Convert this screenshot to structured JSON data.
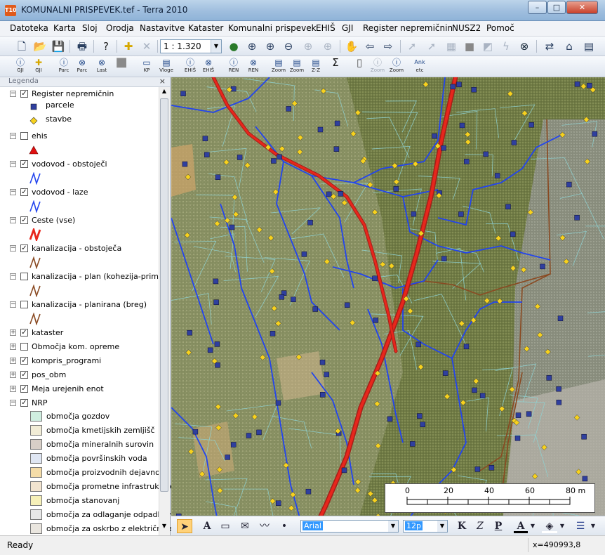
{
  "window": {
    "title": "KOMUNALNI PRISPEVEK.tef - Terra 2010",
    "app_icon_text": "T10"
  },
  "window_controls": {
    "minimize": "–",
    "maximize": "□",
    "close": "✕"
  },
  "menu": [
    "Datoteka",
    "Karta",
    "Sloj",
    "Orodja",
    "Nastavitve",
    "Kataster",
    "Komunalni prispevek",
    "EHIŠ",
    "GJI",
    "Register nepremičnin",
    "NUSZ2",
    "Pomoč"
  ],
  "toolbar": {
    "scale_value": "1 : 1.320"
  },
  "toolbar2": [
    {
      "label": "GJI",
      "icon": "info-icon"
    },
    {
      "label": "GJI",
      "icon": "import-icon"
    },
    {
      "label": "Parc",
      "icon": "info-icon"
    },
    {
      "label": "Parc",
      "icon": "binoculars-icon"
    },
    {
      "label": "Last",
      "icon": "binoculars-icon"
    },
    {
      "label": "",
      "icon": "gray-square-icon"
    },
    {
      "label": "KP",
      "icon": "document-icon"
    },
    {
      "label": "Vloge",
      "icon": "table-icon"
    },
    {
      "label": "EHIŠ",
      "icon": "info-icon"
    },
    {
      "label": "EHIŠ",
      "icon": "binoculars-icon"
    },
    {
      "label": "REN",
      "icon": "info-icon"
    },
    {
      "label": "REN",
      "icon": "binoculars-icon"
    },
    {
      "label": "Zoom",
      "icon": "table-icon"
    },
    {
      "label": "Zoom",
      "icon": "table-icon"
    },
    {
      "label": "Z-Z",
      "icon": "table-icon"
    },
    {
      "label": "",
      "icon": "sigma-icon"
    },
    {
      "label": "",
      "icon": "document-icon"
    },
    {
      "label": "Zoom",
      "icon": "info-icon"
    },
    {
      "label": "Zoom",
      "icon": "info-icon"
    },
    {
      "label": "Ank etc",
      "icon": "text-icon"
    }
  ],
  "legend": {
    "title": "Legenda",
    "close": "×",
    "layers": [
      {
        "name": "Register nepremičnin",
        "checked": true,
        "expand": "−",
        "children": [
          {
            "label": "parcele",
            "symbol": "blue-square"
          },
          {
            "label": "stavbe",
            "symbol": "yellow-diamond"
          }
        ]
      },
      {
        "name": "ehis",
        "checked": false,
        "expand": "−",
        "symbol": "red-triangle"
      },
      {
        "name": "vodovod - obstoječi",
        "checked": true,
        "expand": "−",
        "symbol": "blue-line"
      },
      {
        "name": "vodovod - laze",
        "checked": true,
        "expand": "−",
        "symbol": "blue-line"
      },
      {
        "name": "Ceste (vse)",
        "checked": true,
        "expand": "−",
        "symbol": "red-line"
      },
      {
        "name": "kanalizacija - obstoječa",
        "checked": true,
        "expand": "−",
        "symbol": "brown-line"
      },
      {
        "name": "kanalizacija - plan (kohezija-primar)",
        "checked": false,
        "expand": "−",
        "symbol": "brown-line"
      },
      {
        "name": "kanalizacija - planirana (breg)",
        "checked": false,
        "expand": "−",
        "symbol": "brown-line"
      },
      {
        "name": "kataster",
        "checked": true,
        "expand": "+"
      },
      {
        "name": "Območja kom. opreme",
        "checked": false,
        "expand": "+"
      },
      {
        "name": "kompris_programi",
        "checked": true,
        "expand": "+"
      },
      {
        "name": "pos_obm",
        "checked": true,
        "expand": "+"
      },
      {
        "name": "Meja urejenih enot",
        "checked": true,
        "expand": "+"
      },
      {
        "name": "NRP",
        "checked": true,
        "expand": "−",
        "children": [
          {
            "label": "območja gozdov",
            "color": "#cfeee0"
          },
          {
            "label": "območja kmetijskih zemljišč",
            "color": "#f1ecd6"
          },
          {
            "label": "območja mineralnih surovin",
            "color": "#d8cfc7"
          },
          {
            "label": "območja površinskih voda",
            "color": "#dfe6f3"
          },
          {
            "label": "območja proizvodnih dejavnosti",
            "color": "#f4dca8"
          },
          {
            "label": "območja prometne infrastrukture",
            "color": "#f2e4cf"
          },
          {
            "label": "območja stanovanj",
            "color": "#f6f0b8"
          },
          {
            "label": "območja za odlaganje odpadkov",
            "color": "#e6e6e6"
          },
          {
            "label": "območja za oskrbo z električno en",
            "color": "#eae6df"
          }
        ]
      }
    ]
  },
  "scalebar": {
    "ticks": [
      "0",
      "20",
      "40",
      "60",
      "80 m"
    ]
  },
  "drawing_toolbar": {
    "font": "Arial",
    "size": "12p",
    "bold": "K",
    "italic": "Z",
    "underline": "P",
    "font_color_label": "A"
  },
  "colors": {
    "road": "#e8261c",
    "water": "#2244ee",
    "sewer": "#8a4a22",
    "parcel": "#2f3f9e",
    "building": "#f7d21e"
  },
  "status": {
    "text": "Ready",
    "coords": "x=490993,8"
  }
}
